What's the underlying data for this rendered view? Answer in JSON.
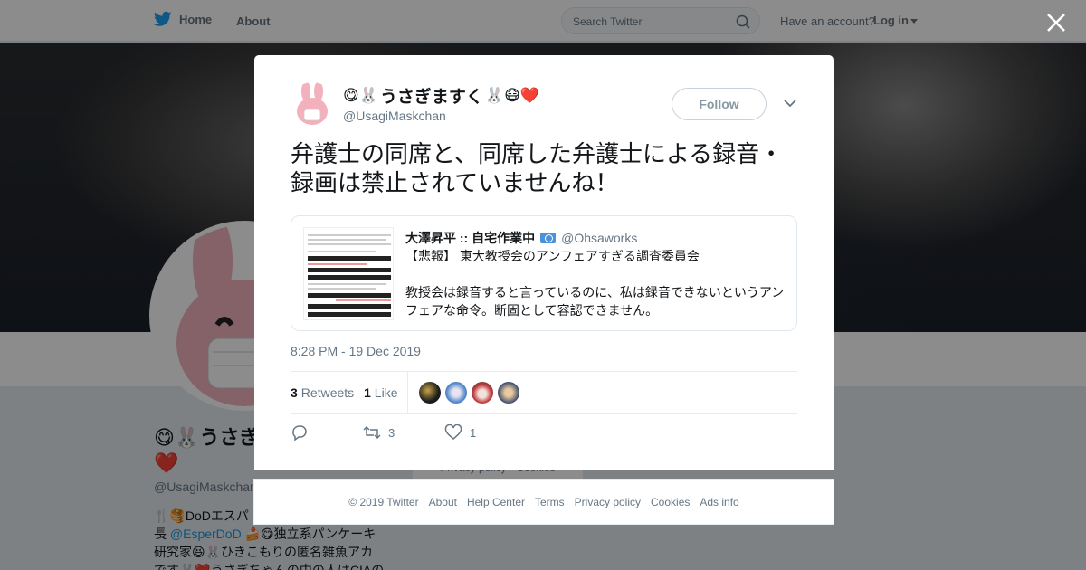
{
  "topbar": {
    "home_label": "Home",
    "about_label": "About",
    "search_placeholder": "Search Twitter",
    "have_account": "Have an account?",
    "login_label": "Log in"
  },
  "background_profile": {
    "name": "😋🐰うさぎますく🐰😷❤️",
    "handle": "@UsagiMaskchan",
    "bio_line1": "🍴🥞DoDエスパ",
    "bio_line2_prefix": "長 ",
    "bio_link": "@EsperDoD",
    "bio_line2_suffix": " 🍰😋独立系パンケーキ",
    "bio_line3": "研究家😆🐰ひきこもりの匿名雑魚アカ",
    "bio_line4": "です🐰❤️うさぎちゃんの中の人はCIAの",
    "footer_pill": "Privacy policy · Cookies"
  },
  "modal": {
    "author": {
      "name_emoji_pre": "😋🐰",
      "name_text": "うさぎますく",
      "name_emoji_post": "🐰😷❤️",
      "handle": "@UsagiMaskchan"
    },
    "follow_label": "Follow",
    "tweet_text": "弁護士の同席と、同席した弁護士による録音・録画は禁止されていませんね！",
    "quote": {
      "name": "大澤昇平 :: 自宅作業中",
      "handle": "@Ohsaworks",
      "body": "【悲報】 東大教授会のアンフェアすぎる調査委員会\n\n教授会は録音すると言っているのに、私は録音できないというアンフェアな命令。断固として容認できません。"
    },
    "timestamp": "8:28 PM - 19 Dec 2019",
    "retweets_count": "3",
    "retweets_label": "Retweets",
    "likes_count": "1",
    "likes_label": "Like",
    "actions": {
      "reply_count": "",
      "retweet_count": "3",
      "like_count": "1"
    }
  },
  "footer": {
    "links": [
      "© 2019 Twitter",
      "About",
      "Help Center",
      "Terms",
      "Privacy policy",
      "Cookies",
      "Ads info"
    ]
  },
  "colors": {
    "accent": "#1da1f2",
    "text_secondary": "#657786",
    "border": "#e6ecf0"
  },
  "icons": [
    "twitter-bird-icon",
    "search-icon",
    "close-icon",
    "chevron-down-icon",
    "reply-icon",
    "retweet-icon",
    "heart-icon"
  ]
}
